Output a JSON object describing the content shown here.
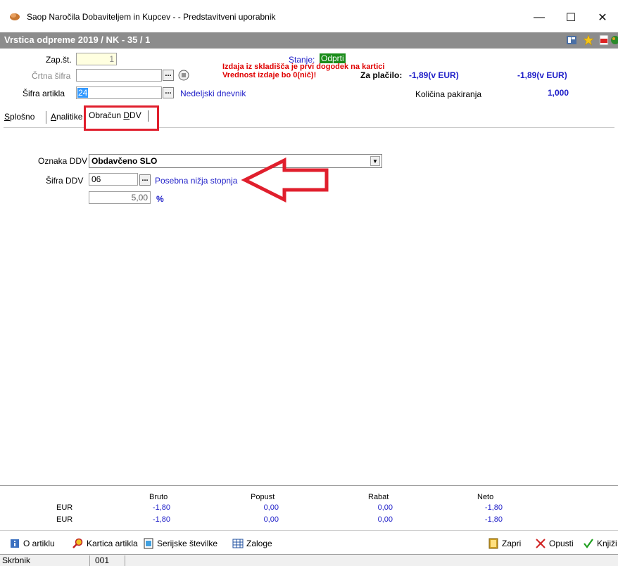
{
  "window": {
    "title": "Saop  Naročila Dobaviteljem in Kupcev -  - Predstavitveni uporabnik",
    "minimize": "—",
    "maximize": "☐",
    "close": "✕"
  },
  "header": {
    "title": "Vrstica odpreme 2019 / NK - 35 / 1"
  },
  "form": {
    "zap_label": "Zap.št.",
    "zap_value": "1",
    "crtna_label": "Črtna šifra",
    "crtna_value": "",
    "sifra_artikla_label": "Šifra artikla",
    "sifra_artikla_value": "24",
    "artikel_name": "Nedeljski dnevnik",
    "dots": "...",
    "stanje_label": "Stanje:",
    "stanje_value": "Odprti",
    "warning_line1": "Izdaja iz skladišča je prvi dogodek na kartici",
    "warning_line2": "Vrednost izdaje bo 0(nič)!",
    "za_placilo_label": "Za plačilo:",
    "za_placilo_value1": "-1,89(v EUR)",
    "za_placilo_value2": "-1,89(v EUR)",
    "kolicina_label": "Količina pakiranja",
    "kolicina_value": "1,000"
  },
  "tabs": [
    {
      "label": "Splošno",
      "underline": "S",
      "rest": "plošno"
    },
    {
      "label": "Analitike",
      "underline": "A",
      "rest": "nalitike"
    },
    {
      "label": "Obračun DDV",
      "pre": "Obračun ",
      "underline": "D",
      "rest": "DV"
    }
  ],
  "ddv": {
    "oznaka_label": "Oznaka DDV",
    "oznaka_value": "Obdavčeno SLO",
    "sifra_label": "Šifra DDV",
    "sifra_value": "06",
    "sifra_name": "Posebna nižja stopnja",
    "stopnja_value": "5,00",
    "stopnja_unit": "%"
  },
  "totals": {
    "headers": [
      "Bruto",
      "Popust",
      "Rabat",
      "Neto"
    ],
    "rows": [
      {
        "currency": "EUR",
        "values": [
          "-1,80",
          "0,00",
          "0,00",
          "-1,80"
        ]
      },
      {
        "currency": "EUR",
        "values": [
          "-1,80",
          "0,00",
          "0,00",
          "-1,80"
        ]
      }
    ]
  },
  "toolbar": {
    "o_artiklu": "O artiklu",
    "kartica": "Kartica artikla",
    "serijske": "Serijske številke",
    "zaloge": "Zaloge",
    "zapri": "Zapri",
    "opusti": "Opusti",
    "knjizi": "Knjiži"
  },
  "status": {
    "user": "Skrbnik",
    "code": "001"
  },
  "colors": {
    "header_bg": "#8c8c8c",
    "highlight": "#e01f2d",
    "accent_blue": "#1e1ec8",
    "stanje_bg": "#1a8c1a",
    "warning": "#e00000"
  }
}
